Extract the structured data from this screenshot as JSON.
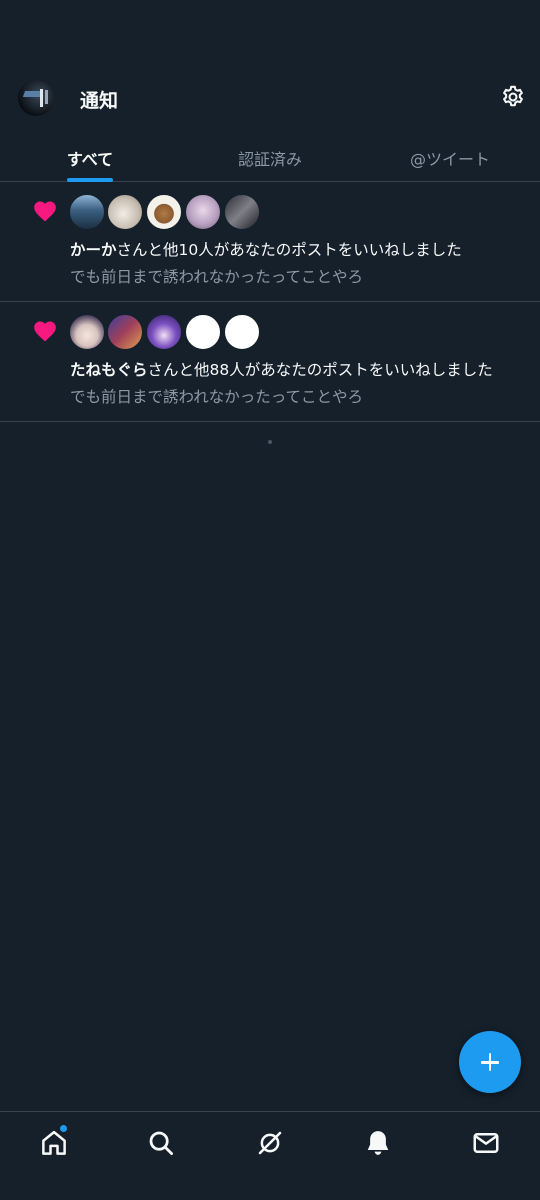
{
  "header": {
    "title": "通知",
    "avatar_icon": "profile-avatar",
    "settings_icon": "gear-icon"
  },
  "tabs": [
    {
      "label": "すべて",
      "active": true
    },
    {
      "label": "認証済み",
      "active": false
    },
    {
      "label": "@ツイート",
      "active": false
    }
  ],
  "notifications": [
    {
      "icon": "heart-icon",
      "bold_name": "かーか",
      "text_rest": "さんと他10人があなたのポストをいいねしました",
      "preview": "でも前日まで誘われなかったってことやろ",
      "avatar_count": 5
    },
    {
      "icon": "heart-icon",
      "bold_name": "たねもぐら",
      "text_rest": "さんと他88人があなたのポストをいいねしました",
      "preview": "でも前日まで誘われなかったってことやろ",
      "avatar_count": 5
    }
  ],
  "fab": {
    "icon": "plus-icon"
  },
  "bottom_nav": [
    {
      "name": "home",
      "icon": "home-icon",
      "badge": true
    },
    {
      "name": "search",
      "icon": "search-icon",
      "badge": false
    },
    {
      "name": "spaces",
      "icon": "spaces-icon",
      "badge": false
    },
    {
      "name": "notifications",
      "icon": "bell-icon",
      "badge": false
    },
    {
      "name": "messages",
      "icon": "mail-icon",
      "badge": false
    }
  ],
  "colors": {
    "background": "#15202b",
    "accent": "#1d9bf0",
    "like": "#f91880",
    "divider": "#38444d",
    "secondary_text": "#8b98a5"
  }
}
